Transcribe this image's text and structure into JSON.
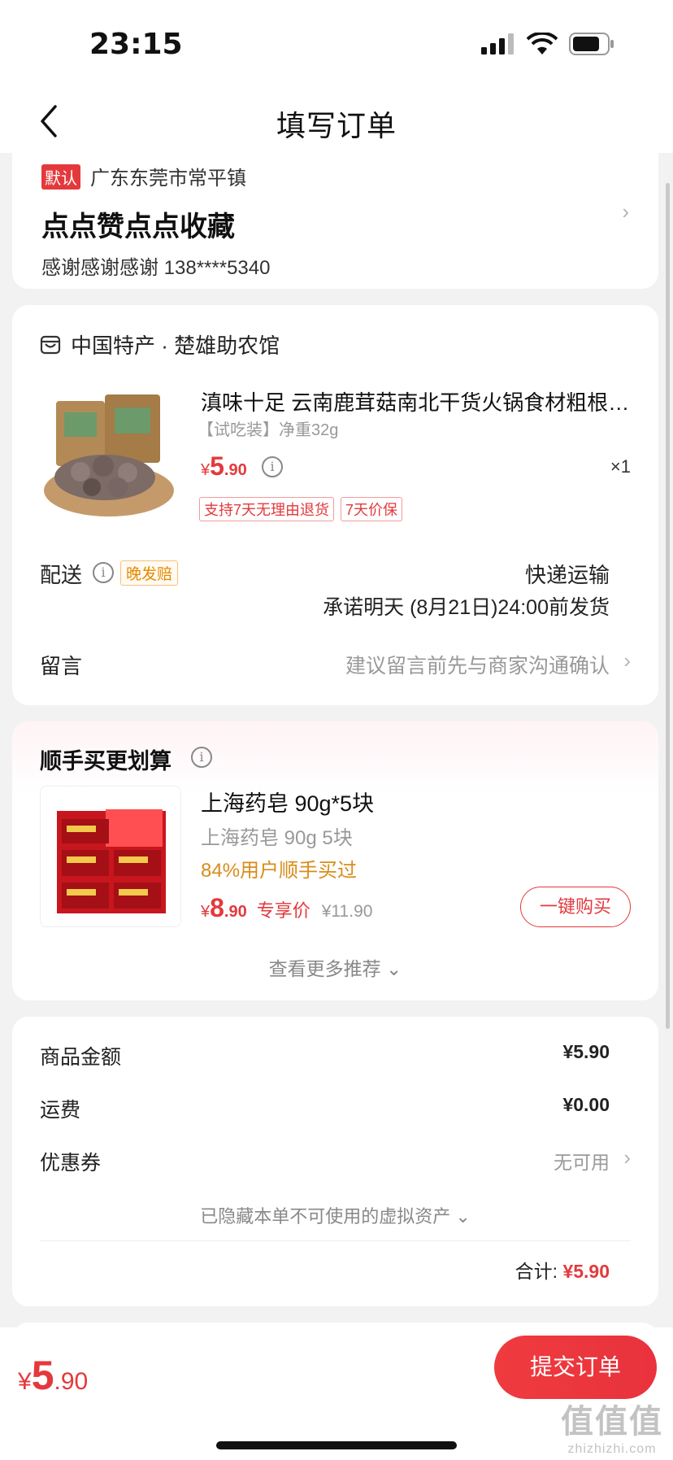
{
  "status": {
    "time": "23:15"
  },
  "nav": {
    "title": "填写订单"
  },
  "address": {
    "badge": "默认",
    "region": "广东东莞市常平镇",
    "name": "点点赞点点收藏",
    "contact": "感谢感谢感谢  138****5340"
  },
  "store": {
    "name": "中国特产 · 楚雄助农馆"
  },
  "product": {
    "title": "滇味十足 云南鹿茸菇南北干货火锅食材粗根…",
    "spec": "【试吃装】净重32g",
    "price_yen": "¥",
    "price_int": "5",
    "price_dec": ".90",
    "qty": "×1",
    "tags": [
      "支持7天无理由退货",
      "7天价保"
    ]
  },
  "shipping": {
    "label": "配送",
    "late_tag": "晚发赔",
    "method": "快递运输",
    "promise": "承诺明天 (8月21日)24:00前发货"
  },
  "note": {
    "label": "留言",
    "hint": "建议留言前先与商家沟通确认"
  },
  "recommend": {
    "title": "顺手买更划算",
    "name": "上海药皂 90g*5块",
    "spec": "上海药皂 90g 5块",
    "bought": "84%用户顺手买过",
    "price_yen": "¥",
    "price_int": "8",
    "price_dec": ".90",
    "exclusive": "专享价",
    "orig_price": "¥11.90",
    "buy_button": "一键购买",
    "more": "查看更多推荐 ⌄"
  },
  "summary": {
    "goods_label": "商品金额",
    "goods_value": "¥5.90",
    "freight_label": "运费",
    "freight_value": "¥0.00",
    "coupon_label": "优惠券",
    "coupon_value": "无可用",
    "hidden_assets": "已隐藏本单不可使用的虚拟资产 ⌄",
    "total_label": "合计:",
    "total_value": "¥5.90"
  },
  "bottom": {
    "price_yen": "¥",
    "price_int": "5",
    "price_dec": ".90",
    "submit": "提交订单"
  },
  "watermark": {
    "big": "值值值",
    "small": "zhizhizhi.com"
  },
  "colors": {
    "accent": "#e4393c",
    "orange": "#d98c1a",
    "background": "#f2f2f2"
  }
}
